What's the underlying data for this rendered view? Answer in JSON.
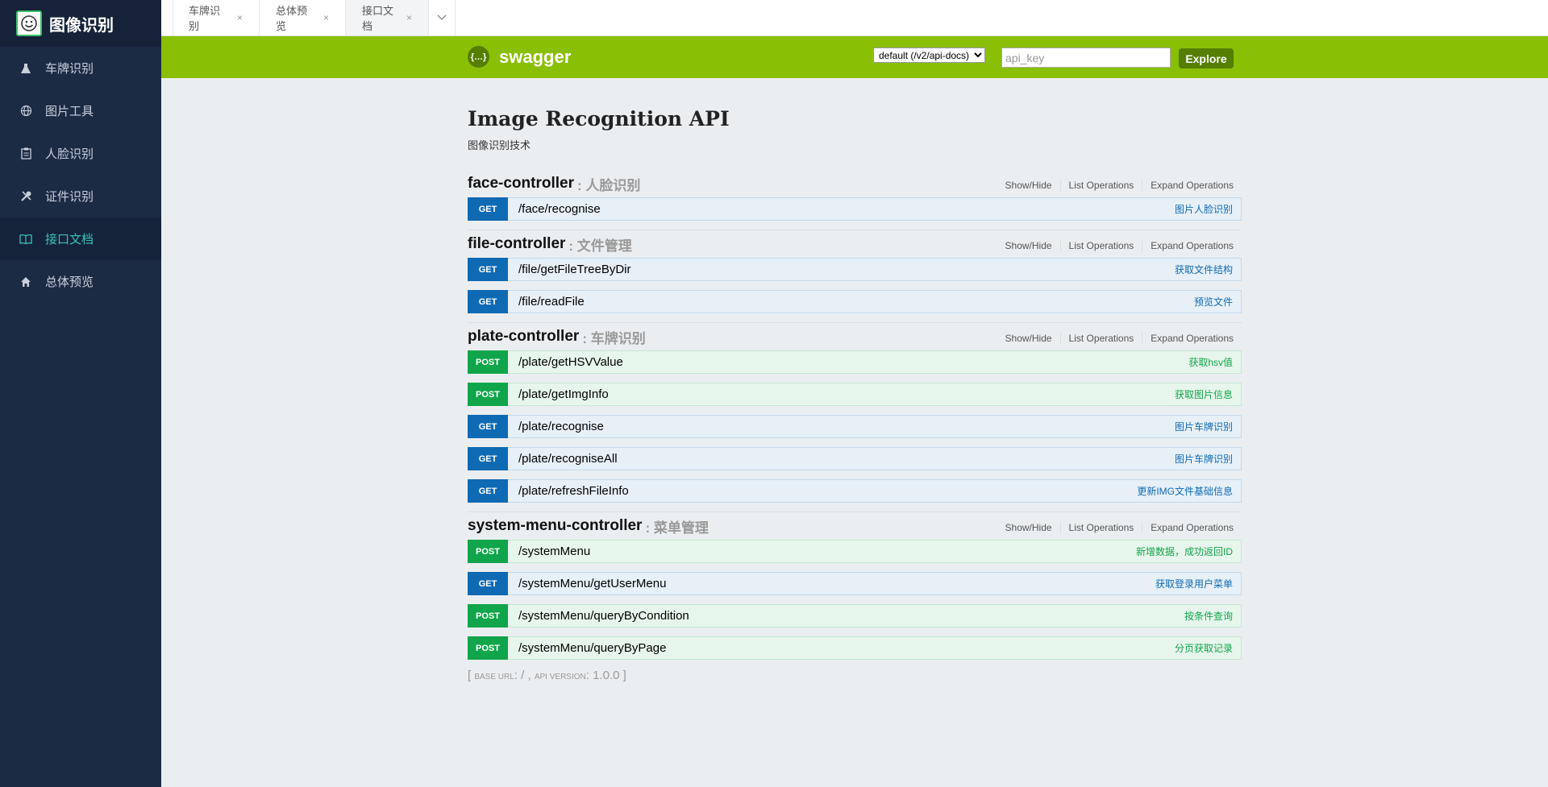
{
  "sidebar": {
    "title": "图像识别",
    "items": [
      {
        "label": "车牌识别",
        "icon": "flask-icon"
      },
      {
        "label": "图片工具",
        "icon": "globe-icon"
      },
      {
        "label": "人脸识别",
        "icon": "clipboard-icon"
      },
      {
        "label": "证件识别",
        "icon": "tools-icon"
      },
      {
        "label": "接口文档",
        "icon": "book-icon",
        "active": true
      },
      {
        "label": "总体预览",
        "icon": "home-icon"
      }
    ]
  },
  "tabs": [
    {
      "label": "车牌识别",
      "close": "×"
    },
    {
      "label": "总体预览",
      "close": "×"
    },
    {
      "label": "接口文档",
      "close": "×",
      "active": true
    }
  ],
  "swagger": {
    "logo_text": "swagger",
    "logo_glyph": "{…}",
    "spec_select": "default (/v2/api-docs)",
    "api_key_placeholder": "api_key",
    "explore": "Explore"
  },
  "api": {
    "title": "Image Recognition API",
    "description": "图像识别技术"
  },
  "links": {
    "show_hide": "Show/Hide",
    "list_ops": "List Operations",
    "expand_ops": "Expand Operations"
  },
  "controllers": [
    {
      "name": "face-controller",
      "desc": ": 人脸识别",
      "ops": [
        {
          "method": "GET",
          "path": "/face/recognise",
          "summary": "图片人脸识别"
        }
      ]
    },
    {
      "name": "file-controller",
      "desc": ": 文件管理",
      "ops": [
        {
          "method": "GET",
          "path": "/file/getFileTreeByDir",
          "summary": "获取文件结构"
        },
        {
          "method": "GET",
          "path": "/file/readFile",
          "summary": "预览文件"
        }
      ]
    },
    {
      "name": "plate-controller",
      "desc": ": 车牌识别",
      "ops": [
        {
          "method": "POST",
          "path": "/plate/getHSVValue",
          "summary": "获取hsv值"
        },
        {
          "method": "POST",
          "path": "/plate/getImgInfo",
          "summary": "获取图片信息"
        },
        {
          "method": "GET",
          "path": "/plate/recognise",
          "summary": "图片车牌识别"
        },
        {
          "method": "GET",
          "path": "/plate/recogniseAll",
          "summary": "图片车牌识别"
        },
        {
          "method": "GET",
          "path": "/plate/refreshFileInfo",
          "summary": "更新IMG文件基础信息"
        }
      ]
    },
    {
      "name": "system-menu-controller",
      "desc": ": 菜单管理",
      "ops": [
        {
          "method": "POST",
          "path": "/systemMenu",
          "summary": "新增数据，成功返回ID"
        },
        {
          "method": "GET",
          "path": "/systemMenu/getUserMenu",
          "summary": "获取登录用户菜单"
        },
        {
          "method": "POST",
          "path": "/systemMenu/queryByCondition",
          "summary": "按条件查询"
        },
        {
          "method": "POST",
          "path": "/systemMenu/queryByPage",
          "summary": "分页获取记录"
        }
      ]
    }
  ],
  "footer": {
    "base_url_label": "base url",
    "base_url": "/",
    "version_label": "api version",
    "version": "1.0.0"
  },
  "colors": {
    "swagger_green": "#89bf04",
    "get": "#0f6ab4",
    "post": "#10a54a",
    "sidebar_bg": "#1c2b44",
    "active_nav": "#3cc1b6"
  }
}
